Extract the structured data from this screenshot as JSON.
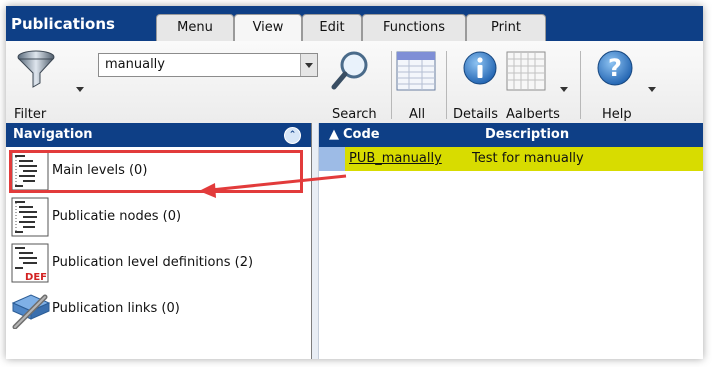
{
  "app": {
    "title": "Publications"
  },
  "tabs": [
    {
      "label": "Menu"
    },
    {
      "label": "View"
    },
    {
      "label": "Edit"
    },
    {
      "label": "Functions"
    },
    {
      "label": "Print"
    }
  ],
  "ribbon": {
    "filter_label": "Filter",
    "filter_value": "manually",
    "search_label": "Search",
    "all_label": "All",
    "details_label": "Details",
    "aalberts_label": "Aalberts",
    "help_label": "Help"
  },
  "navigation": {
    "title": "Navigation",
    "items": [
      {
        "label": "Main levels (0)",
        "icon": "tree-list-icon"
      },
      {
        "label": "Publicatie nodes (0)",
        "icon": "tree-list-icon"
      },
      {
        "label": "Publication level definitions (2)",
        "icon": "tree-def-icon"
      },
      {
        "label": "Publication links (0)",
        "icon": "links-icon"
      }
    ]
  },
  "grid": {
    "columns": [
      {
        "label": "Code"
      },
      {
        "label": "Description"
      }
    ],
    "rows": [
      {
        "code": "PUB_manually",
        "description": "Test for manually"
      }
    ]
  },
  "colors": {
    "header_blue": "#0e3f86",
    "row_highlight": "#d8dc00",
    "annotation_red": "#e23b3b"
  }
}
